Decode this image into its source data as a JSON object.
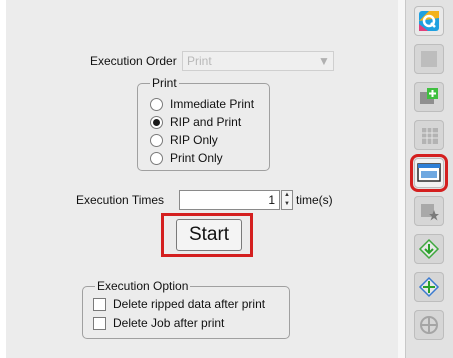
{
  "execution_order": {
    "label": "Execution Order",
    "value": "Print"
  },
  "print_group": {
    "title": "Print",
    "options": [
      {
        "label": "Immediate Print",
        "checked": false
      },
      {
        "label": "RIP and Print",
        "checked": true
      },
      {
        "label": "RIP Only",
        "checked": false
      },
      {
        "label": "Print Only",
        "checked": false
      }
    ]
  },
  "execution_times": {
    "label": "Execution Times",
    "value": "1",
    "unit": "time(s)"
  },
  "start_button": {
    "label": "Start"
  },
  "execution_option": {
    "title": "Execution Option",
    "options": [
      {
        "label": "Delete ripped data after print",
        "checked": false
      },
      {
        "label": "Delete Job after print",
        "checked": false
      }
    ]
  },
  "right_toolbar": {
    "buttons": [
      {
        "icon": "app-logo-icon",
        "active": false
      },
      {
        "icon": "blank-icon",
        "active": false
      },
      {
        "icon": "image-add-icon",
        "active": false
      },
      {
        "icon": "grid-tool-icon",
        "active": false
      },
      {
        "icon": "printer-window-icon",
        "active": true
      },
      {
        "icon": "star-tool-icon",
        "active": false
      },
      {
        "icon": "layer-down-icon",
        "active": false
      },
      {
        "icon": "layer-move-icon",
        "active": false
      },
      {
        "icon": "crosshair-icon",
        "active": false
      }
    ]
  }
}
